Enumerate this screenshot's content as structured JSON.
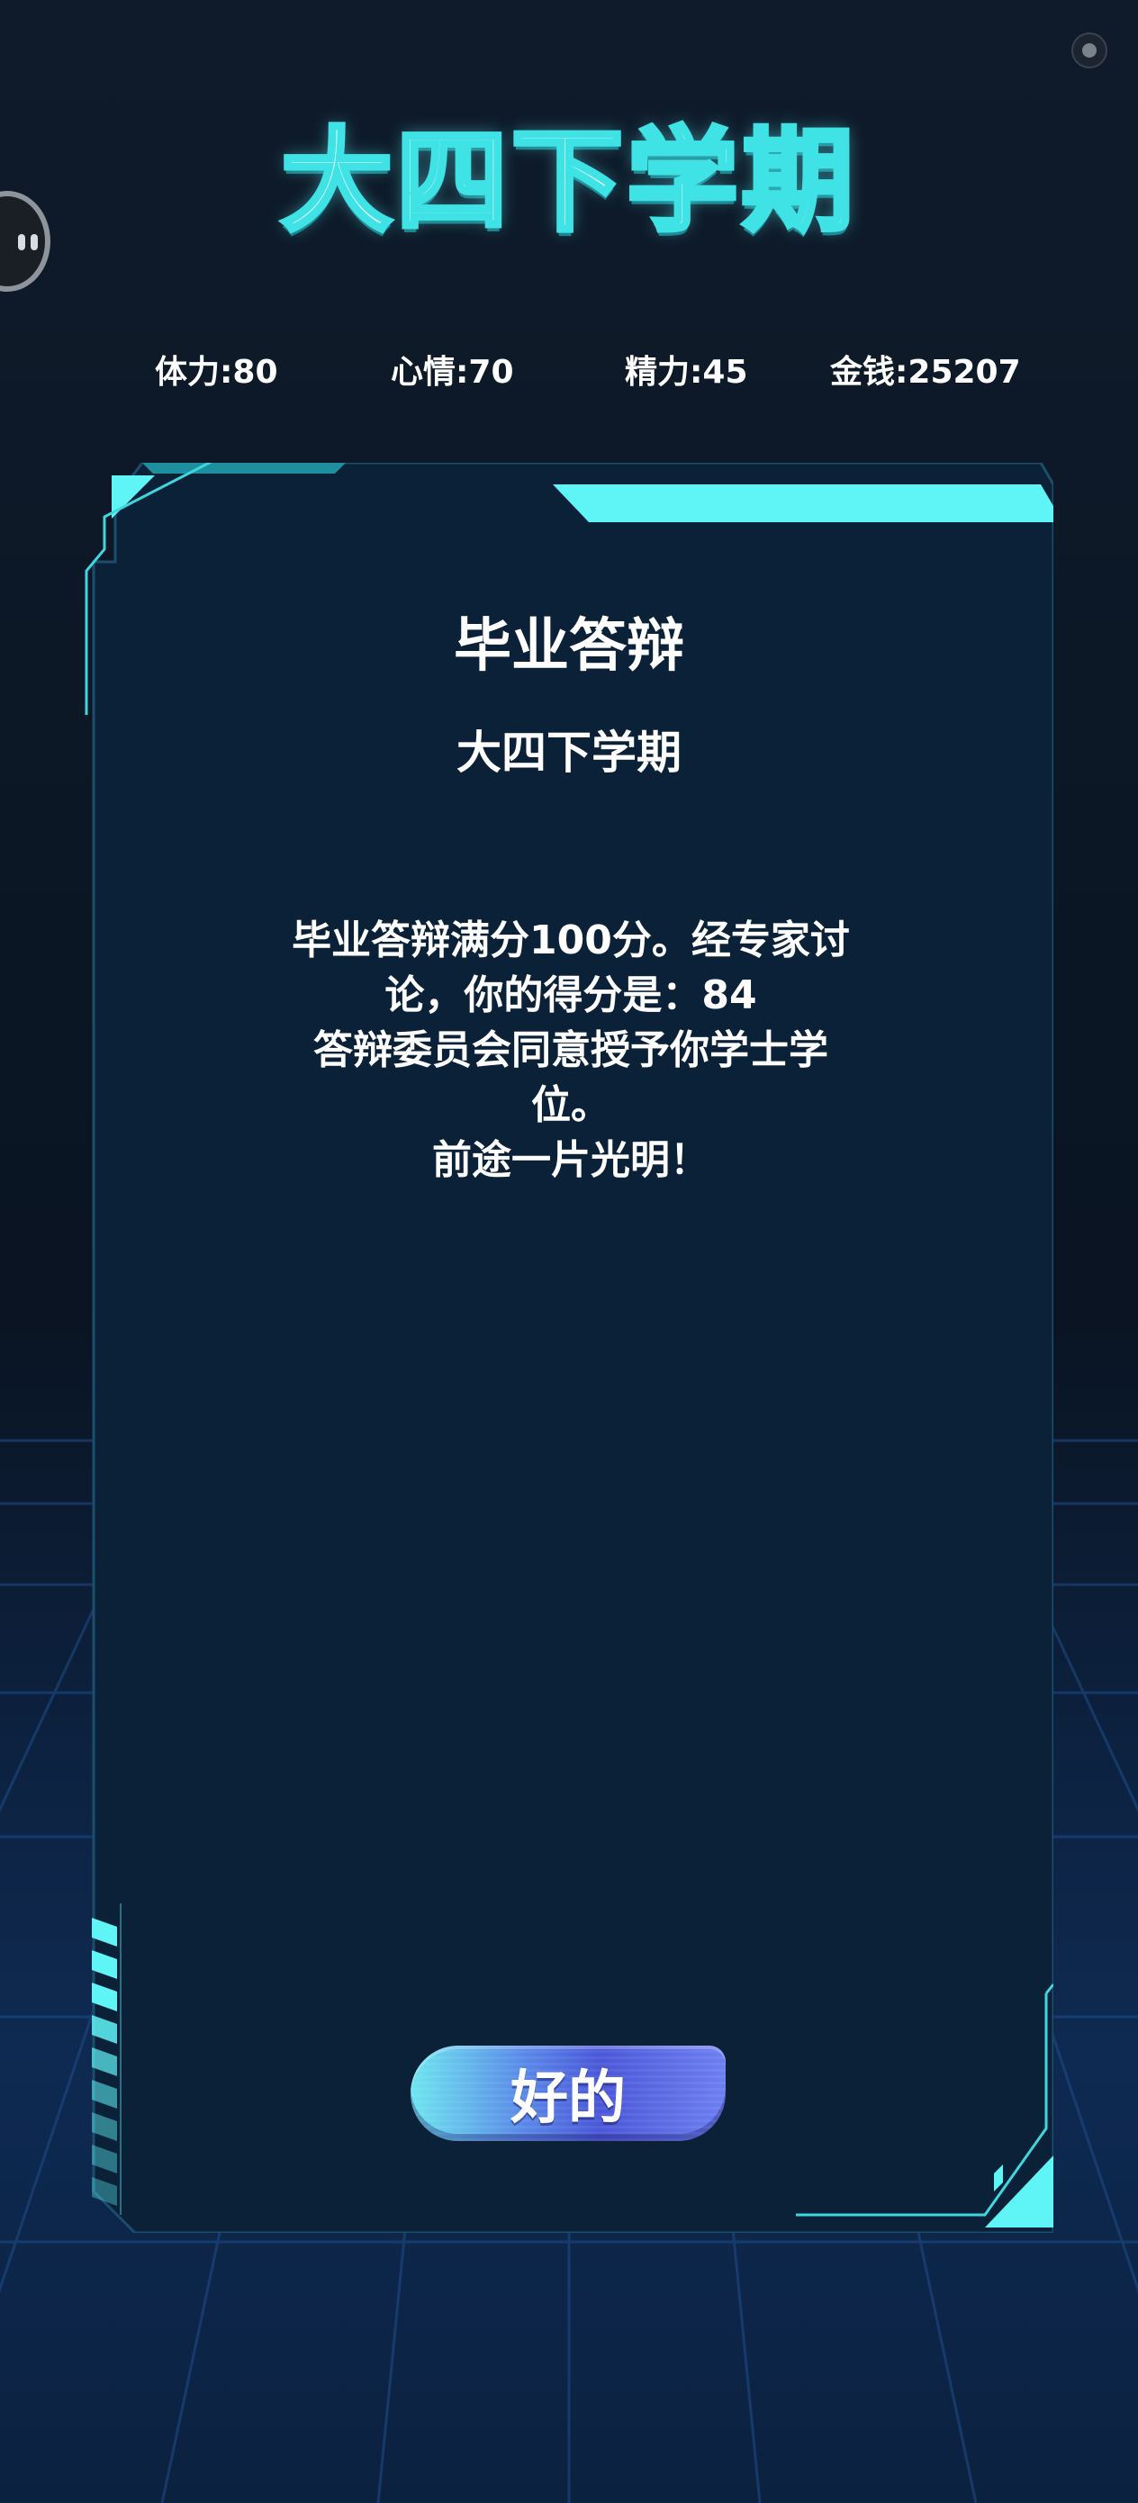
{
  "header": {
    "title": "大四下学期"
  },
  "stats": [
    {
      "label": "体力",
      "value": "80",
      "text": "体力:80"
    },
    {
      "label": "心情",
      "value": "70",
      "text": "心情:70"
    },
    {
      "label": "精力",
      "value": "45",
      "text": "精力:45"
    },
    {
      "label": "金钱",
      "value": "25207",
      "text": "金钱:25207"
    }
  ],
  "event_card": {
    "title": "毕业答辩",
    "subtitle": "大四下学期",
    "body_lines": [
      "毕业答辩满分100分。经专家讨",
      "论，你的得分是：84",
      "答辩委员会同意授予你学士学",
      "位。",
      "前途一片光明！"
    ],
    "confirm_label": "好的"
  },
  "colors": {
    "accent_cyan": "#5ff5f7",
    "card_bg": "#0b2138",
    "page_bg": "#0c1826"
  },
  "icons": {
    "top_right": "close-icon",
    "left_edge": "assistant-bubble-icon"
  }
}
